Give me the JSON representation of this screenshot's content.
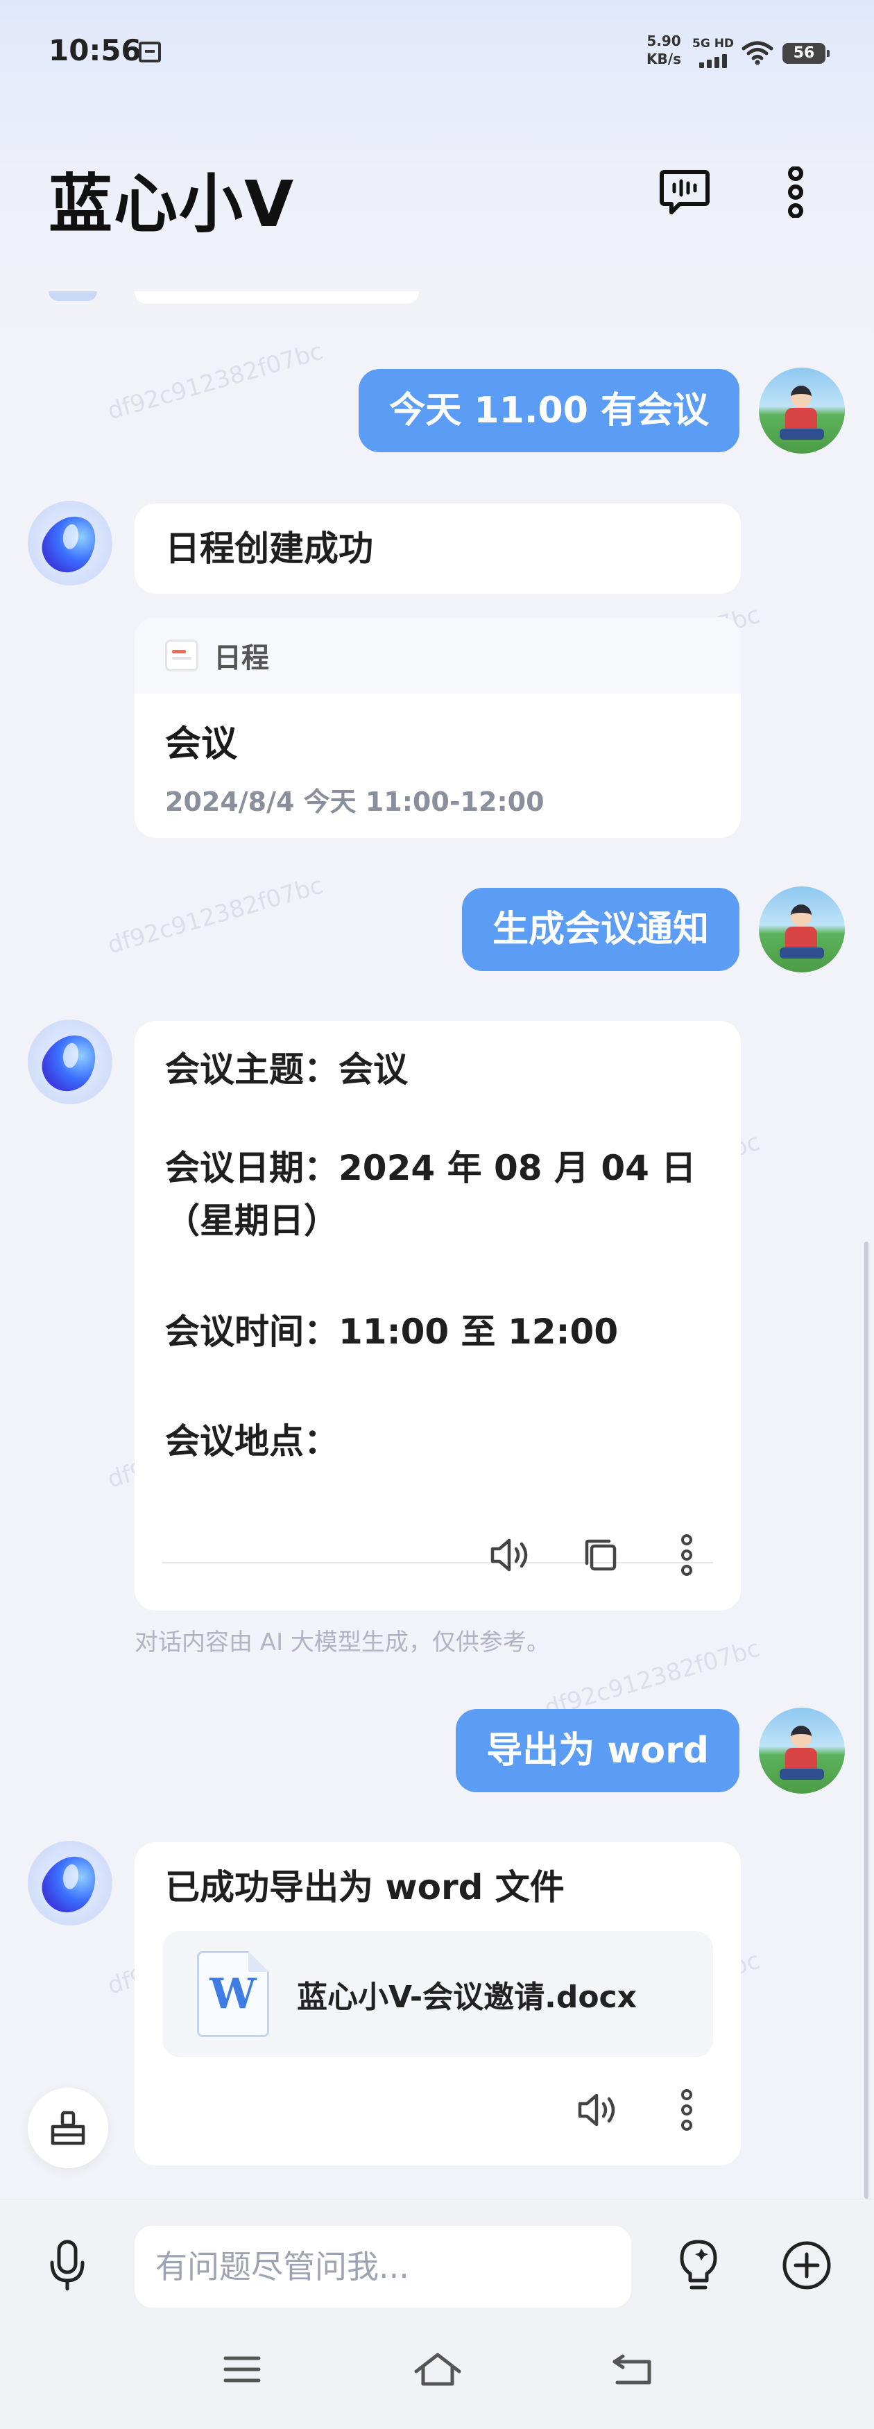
{
  "status_bar": {
    "time": "10:56",
    "speed_value": "5.90",
    "speed_unit": "KB/s",
    "network": "5G HD",
    "battery": "56"
  },
  "header": {
    "title": "蓝心小V",
    "voice_chat_icon": "voice-message-icon",
    "more_icon": "more-vertical-icon"
  },
  "watermark": "df92c912382f07bc",
  "messages": [
    {
      "role": "user",
      "text": "今天 11.00 有会议"
    },
    {
      "role": "bot",
      "text": "日程创建成功",
      "card": {
        "label": "日程",
        "title": "会议",
        "time": "2024/8/4 今天 11:00-12:00"
      }
    },
    {
      "role": "user",
      "text": "生成会议通知"
    },
    {
      "role": "bot",
      "lines": [
        "会议主题：会议",
        "会议日期：2024 年 08 月 04 日（星期日）",
        "会议时间：11:00 至 12:00",
        "会议地点："
      ]
    },
    {
      "role": "user",
      "text": "导出为 word"
    },
    {
      "role": "bot",
      "text": "已成功导出为 word 文件",
      "file": {
        "icon_letter": "W",
        "name": "蓝心小V-会议邀请.docx"
      }
    }
  ],
  "notice": "对话内容由 AI 大模型生成，仅供参考。",
  "input": {
    "placeholder": "有问题尽管问我..."
  },
  "colors": {
    "user_bubble": "#5b9cf5",
    "background": "#f2f3f8",
    "accent": "#4a7df0"
  }
}
